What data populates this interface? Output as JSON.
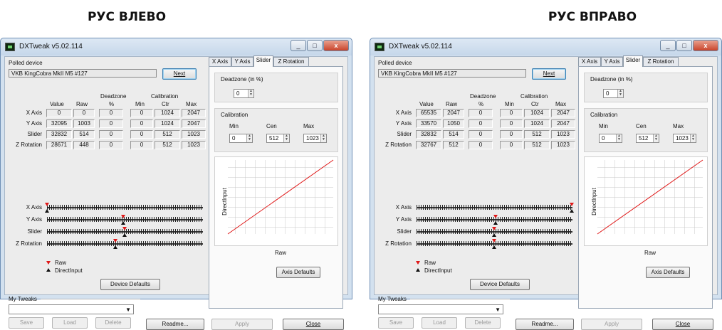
{
  "captions": {
    "left": "РУС ВЛЕВО",
    "right": "РУС ВПРАВО"
  },
  "window": {
    "title": "DXTweak v5.02.114",
    "minimize_icon": "minimize-icon",
    "maximize_icon": "maximize-icon",
    "close_icon": "close-icon"
  },
  "polled": {
    "label": "Polled device",
    "device": "VKB KingCobra MkII M5 #127",
    "next": "Next"
  },
  "headers": {
    "value": "Value",
    "raw": "Raw",
    "deadzone": "Deadzone",
    "pct": "%",
    "calibration": "Calibration",
    "min": "Min",
    "ctr": "Ctr",
    "max": "Max"
  },
  "axes": [
    "X Axis",
    "Y Axis",
    "Slider",
    "Z Rotation"
  ],
  "left_rows": [
    {
      "value": "0",
      "raw": "0",
      "dz": "0",
      "min": "0",
      "ctr": "1024",
      "max": "2047"
    },
    {
      "value": "32095",
      "raw": "1003",
      "dz": "0",
      "min": "0",
      "ctr": "1024",
      "max": "2047"
    },
    {
      "value": "32832",
      "raw": "514",
      "dz": "0",
      "min": "0",
      "ctr": "512",
      "max": "1023"
    },
    {
      "value": "28671",
      "raw": "448",
      "dz": "0",
      "min": "0",
      "ctr": "512",
      "max": "1023"
    }
  ],
  "right_rows": [
    {
      "value": "65535",
      "raw": "2047",
      "dz": "0",
      "min": "0",
      "ctr": "1024",
      "max": "2047"
    },
    {
      "value": "33570",
      "raw": "1050",
      "dz": "0",
      "min": "0",
      "ctr": "1024",
      "max": "2047"
    },
    {
      "value": "32832",
      "raw": "514",
      "dz": "0",
      "min": "0",
      "ctr": "512",
      "max": "1023"
    },
    {
      "value": "32767",
      "raw": "512",
      "dz": "0",
      "min": "0",
      "ctr": "512",
      "max": "1023"
    }
  ],
  "slider_positions": {
    "left": [
      0.0,
      0.49,
      0.5,
      0.44
    ],
    "right": [
      1.0,
      0.51,
      0.5,
      0.5
    ]
  },
  "legend": {
    "raw": "Raw",
    "direct": "DirectInput",
    "raw_color": "#e01818",
    "direct_color": "#111111"
  },
  "device_defaults": "Device Defaults",
  "tweaks": {
    "label": "My Tweaks",
    "save": "Save",
    "load": "Load",
    "delete": "Delete"
  },
  "bottom": {
    "readme": "Readme...",
    "apply": "Apply",
    "close": "Close"
  },
  "tabs": [
    "X Axis",
    "Y Axis",
    "Slider",
    "Z Rotation"
  ],
  "active_tab": "Slider",
  "deadzone": {
    "label": "Deadzone (in %)",
    "value": "0"
  },
  "calib": {
    "label": "Calibration",
    "min_label": "Min",
    "cen_label": "Cen",
    "max_label": "Max",
    "min": "0",
    "cen": "512",
    "max": "1023"
  },
  "graph": {
    "ylabel": "DirectInput",
    "xlabel": "Raw",
    "line_color": "#e01818"
  },
  "axis_defaults": "Axis Defaults"
}
